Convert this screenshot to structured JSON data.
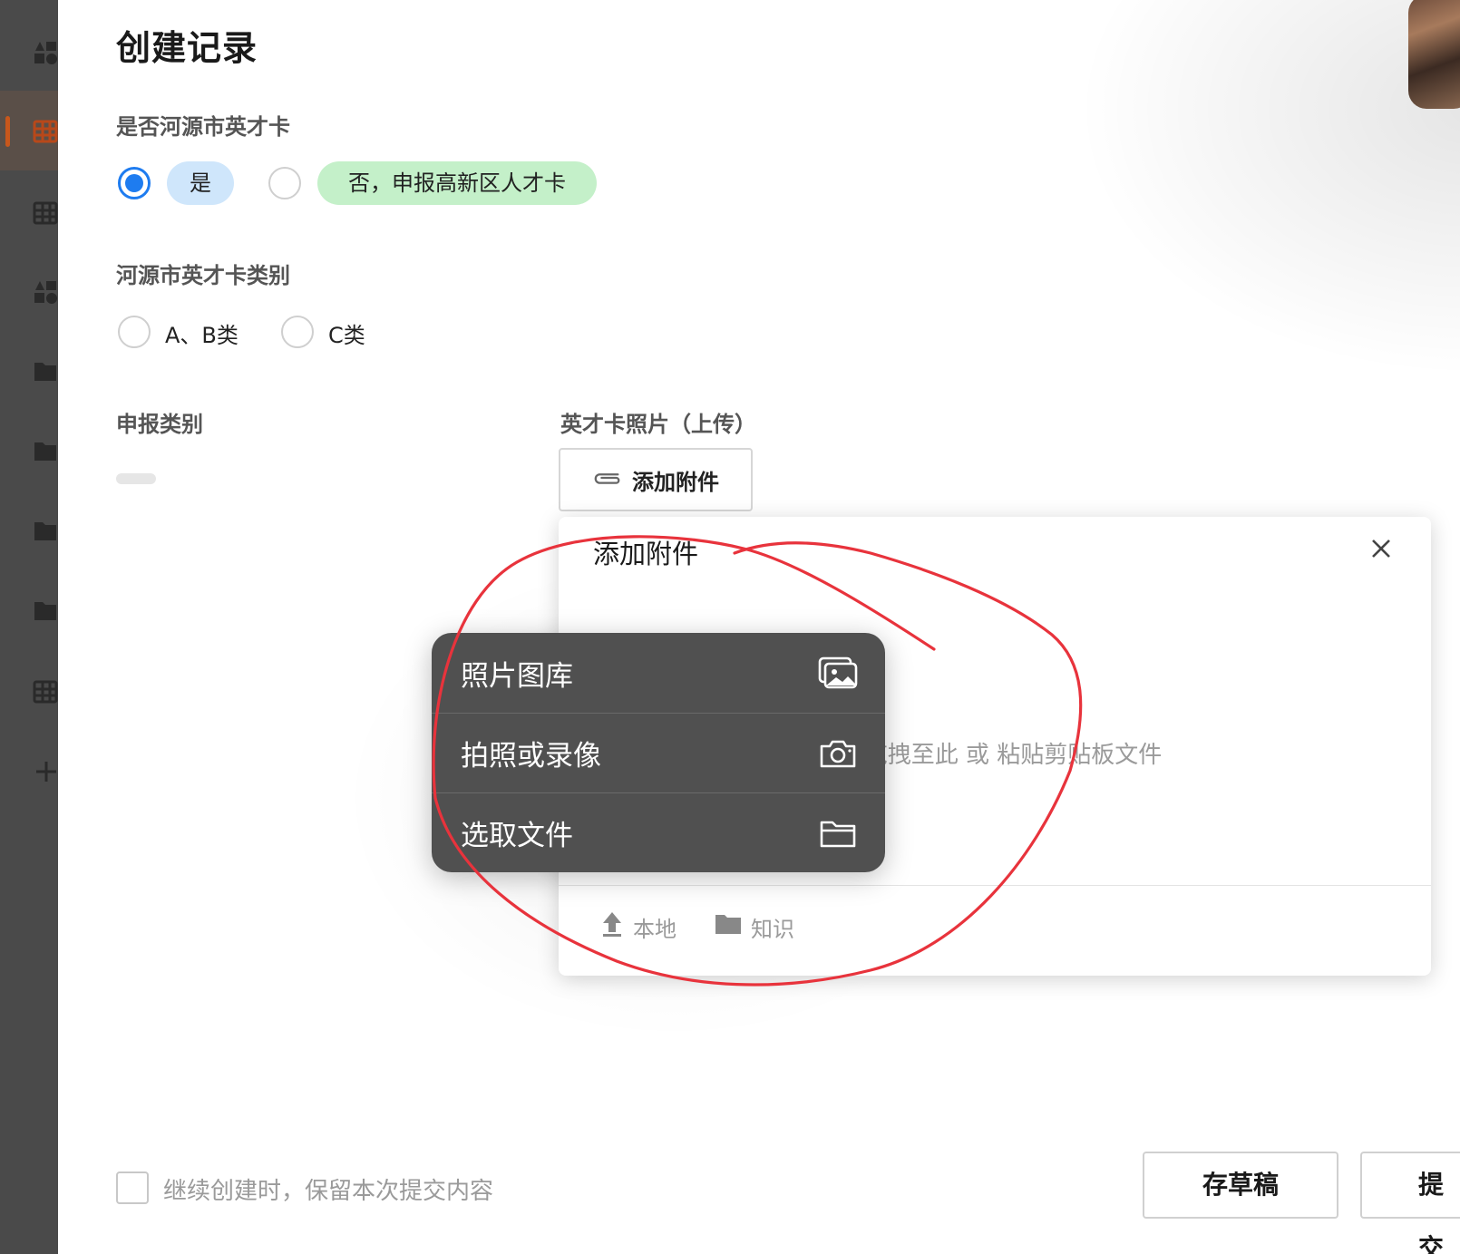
{
  "sidebar": {
    "icons": [
      "shapes-icon",
      "table-icon",
      "table-icon",
      "shapes-icon",
      "folder-icon",
      "folder-icon",
      "folder-icon",
      "folder-icon",
      "table-icon"
    ],
    "add_icon": "plus-icon"
  },
  "form": {
    "title": "创建记录",
    "field1": {
      "label": "是否河源市英才卡",
      "options": [
        "是",
        "否，申报高新区人才卡"
      ],
      "selected": "是"
    },
    "field2": {
      "label": "河源市英才卡类别",
      "options": [
        "A、B类",
        "C类"
      ]
    },
    "field3": {
      "label": "申报类别"
    },
    "field4": {
      "label": "英才卡照片（上传）",
      "button_label": "添加附件"
    }
  },
  "attach_panel": {
    "title": "添加附件",
    "hint": "拖拽至此 或 粘贴剪贴板文件",
    "sources": [
      "本地",
      "知识"
    ]
  },
  "popover_menu": {
    "items": [
      {
        "label": "照片图库",
        "icon": "photo-library-icon"
      },
      {
        "label": "拍照或录像",
        "icon": "camera-icon"
      },
      {
        "label": "选取文件",
        "icon": "folder-icon"
      }
    ]
  },
  "footer": {
    "keep_content_label": "继续创建时，保留本次提交内容",
    "draft_button": "存草稿",
    "submit_button": "提交"
  },
  "colors": {
    "accent_blue": "#1e7cf0",
    "pill_blue": "#cfe6fb",
    "pill_green": "#c4f0c9",
    "sidebar_active": "#c8571c",
    "annotation_red": "#e8333c",
    "menu_bg": "#505050"
  }
}
